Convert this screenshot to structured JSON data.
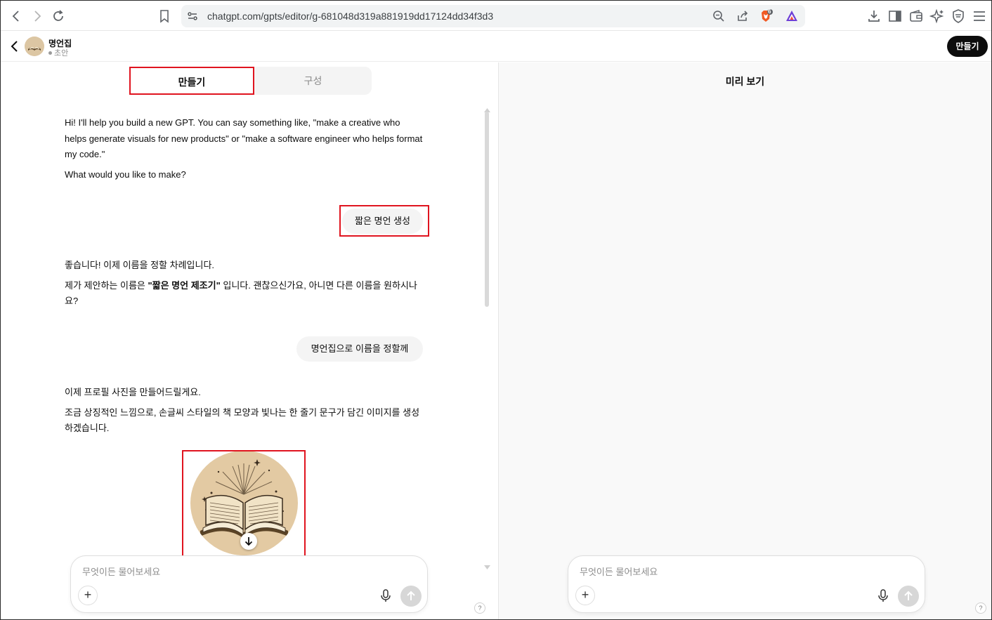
{
  "browser": {
    "url": "chatgpt.com/gpts/editor/g-681048d319a881919dd17124dd34f3d3",
    "brave_badge": "6"
  },
  "header": {
    "gpt_name": "명언집",
    "status": "초안",
    "create_button": "만들기"
  },
  "tabs": [
    {
      "label": "만들기"
    },
    {
      "label": "구성"
    }
  ],
  "conversation": {
    "assistant_1": {
      "p1": "Hi! I'll help you build a new GPT. You can say something like, \"make a creative who helps generate visuals for new products\" or \"make a software engineer who helps format my code.\"",
      "p2": "What would you like to make?"
    },
    "user_1": "짧은 명언 생성",
    "assistant_2": {
      "p1": "좋습니다! 이제 이름을 정할 차례입니다.",
      "p2_before": "제가 제안하는 이름은 ",
      "p2_bold": "\"짧은 명언 제조기\"",
      "p2_after": " 입니다. 괜찮으신가요, 아니면 다른 이름을 원하시나요?"
    },
    "user_2": "명언집으로 이름을 정할께",
    "assistant_3": {
      "p1": "이제 프로필 사진을 만들어드릴게요.",
      "p2": "조금 상징적인 느낌으로, 손글씨 스타일의 책 모양과 빛나는 한 줄기 문구가 담긴 이미지를 생성하겠습니다."
    }
  },
  "composer_left": {
    "placeholder": "무엇이든 물어보세요"
  },
  "preview": {
    "title": "미리 보기",
    "composer_placeholder": "무엇이든 물어보세요"
  },
  "help_label": "?",
  "colors": {
    "highlight": "#e0141f",
    "primary_button": "#0d0d0d",
    "bubble": "#f4f4f4",
    "preview_bg": "#f9f9f9"
  }
}
